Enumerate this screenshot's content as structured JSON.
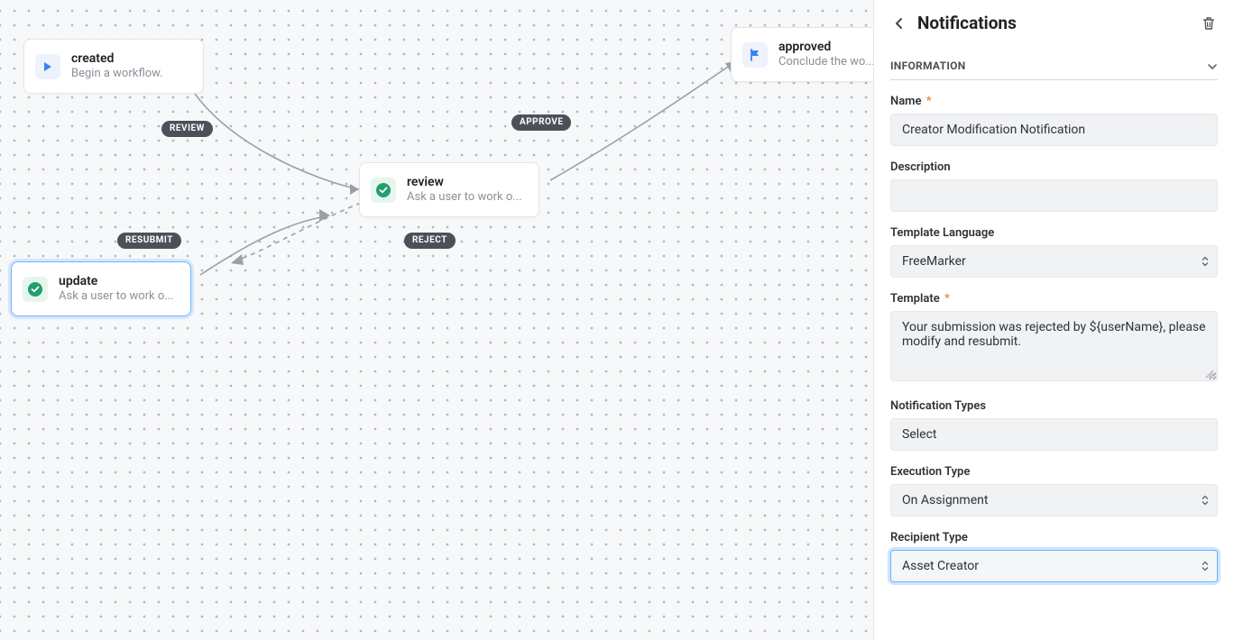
{
  "nodes": {
    "created": {
      "title": "created",
      "sub": "Begin a workflow."
    },
    "review": {
      "title": "review",
      "sub": "Ask a user to work o..."
    },
    "update": {
      "title": "update",
      "sub": "Ask a user to work o..."
    },
    "approved": {
      "title": "approved",
      "sub": "Conclude the wo..."
    }
  },
  "edges": {
    "review": "REVIEW",
    "approve": "APPROVE",
    "reject": "REJECT",
    "resubmit": "RESUBMIT"
  },
  "panel": {
    "title": "Notifications",
    "section_information": "INFORMATION",
    "fields": {
      "name_label": "Name",
      "name_value": "Creator Modification Notification",
      "description_label": "Description",
      "description_value": "",
      "template_lang_label": "Template Language",
      "template_lang_value": "FreeMarker",
      "template_label": "Template",
      "template_value": "Your submission was rejected by ${userName}, please modify and resubmit.",
      "notif_types_label": "Notification Types",
      "notif_types_value": "Select",
      "exec_type_label": "Execution Type",
      "exec_type_value": "On Assignment",
      "recipient_type_label": "Recipient Type",
      "recipient_type_value": "Asset Creator"
    }
  }
}
